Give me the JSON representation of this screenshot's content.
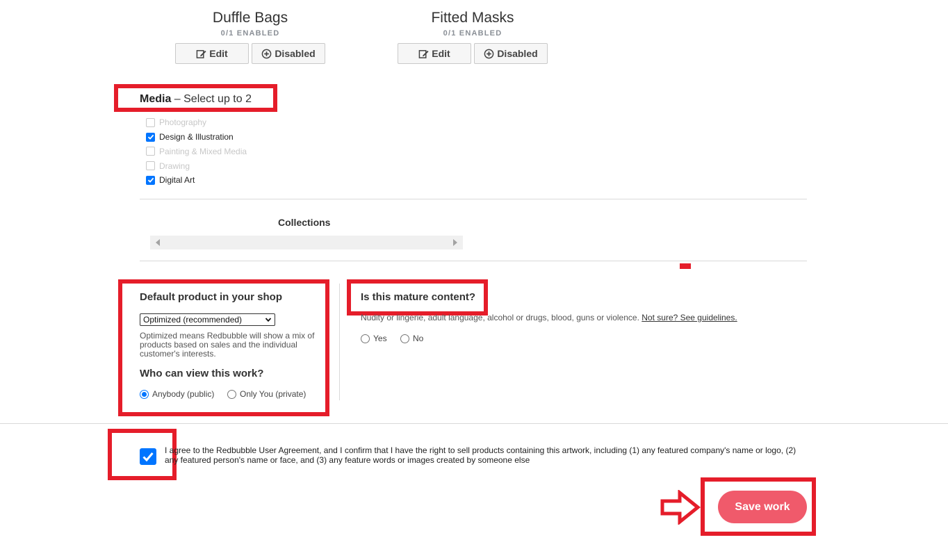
{
  "products": [
    {
      "title": "Duffle Bags",
      "status": "0/1 ENABLED",
      "edit_label": "Edit",
      "toggle_label": "Disabled"
    },
    {
      "title": "Fitted Masks",
      "status": "0/1 ENABLED",
      "edit_label": "Edit",
      "toggle_label": "Disabled"
    }
  ],
  "media": {
    "heading": "Media",
    "subheading": " – Select up to 2",
    "options": [
      {
        "label": "Photography",
        "checked": false,
        "disabled": true
      },
      {
        "label": "Design & Illustration",
        "checked": true,
        "disabled": false
      },
      {
        "label": "Painting & Mixed Media",
        "checked": false,
        "disabled": true
      },
      {
        "label": "Drawing",
        "checked": false,
        "disabled": true
      },
      {
        "label": "Digital Art",
        "checked": true,
        "disabled": false
      }
    ]
  },
  "collections": {
    "title": "Collections"
  },
  "default_product": {
    "title": "Default product in your shop",
    "selected": "Optimized (recommended)",
    "help": "Optimized means Redbubble will show a mix of products based on sales and the individual customer's interests."
  },
  "visibility": {
    "title": "Who can view this work?",
    "options": [
      {
        "label": "Anybody (public)",
        "selected": true
      },
      {
        "label": "Only You (private)",
        "selected": false
      }
    ]
  },
  "mature": {
    "title": "Is this mature content?",
    "description": "Nudity or lingerie, adult language, alcohol or drugs, blood, guns or violence.",
    "guidelines_link": "Not sure? See guidelines.",
    "options": [
      {
        "label": "Yes",
        "selected": false
      },
      {
        "label": "No",
        "selected": false
      }
    ]
  },
  "agreement": {
    "checked": true,
    "text": "I agree to the Redbubble User Agreement, and I confirm that I have the right to sell products containing this artwork, including (1) any featured company's name or logo, (2) any featured person's name or face, and (3) any feature words or images created by someone else"
  },
  "save_label": "Save work",
  "colors": {
    "accent": "#0075ff",
    "save_button": "#f05a6b",
    "annotation_red": "#e51d2a"
  }
}
